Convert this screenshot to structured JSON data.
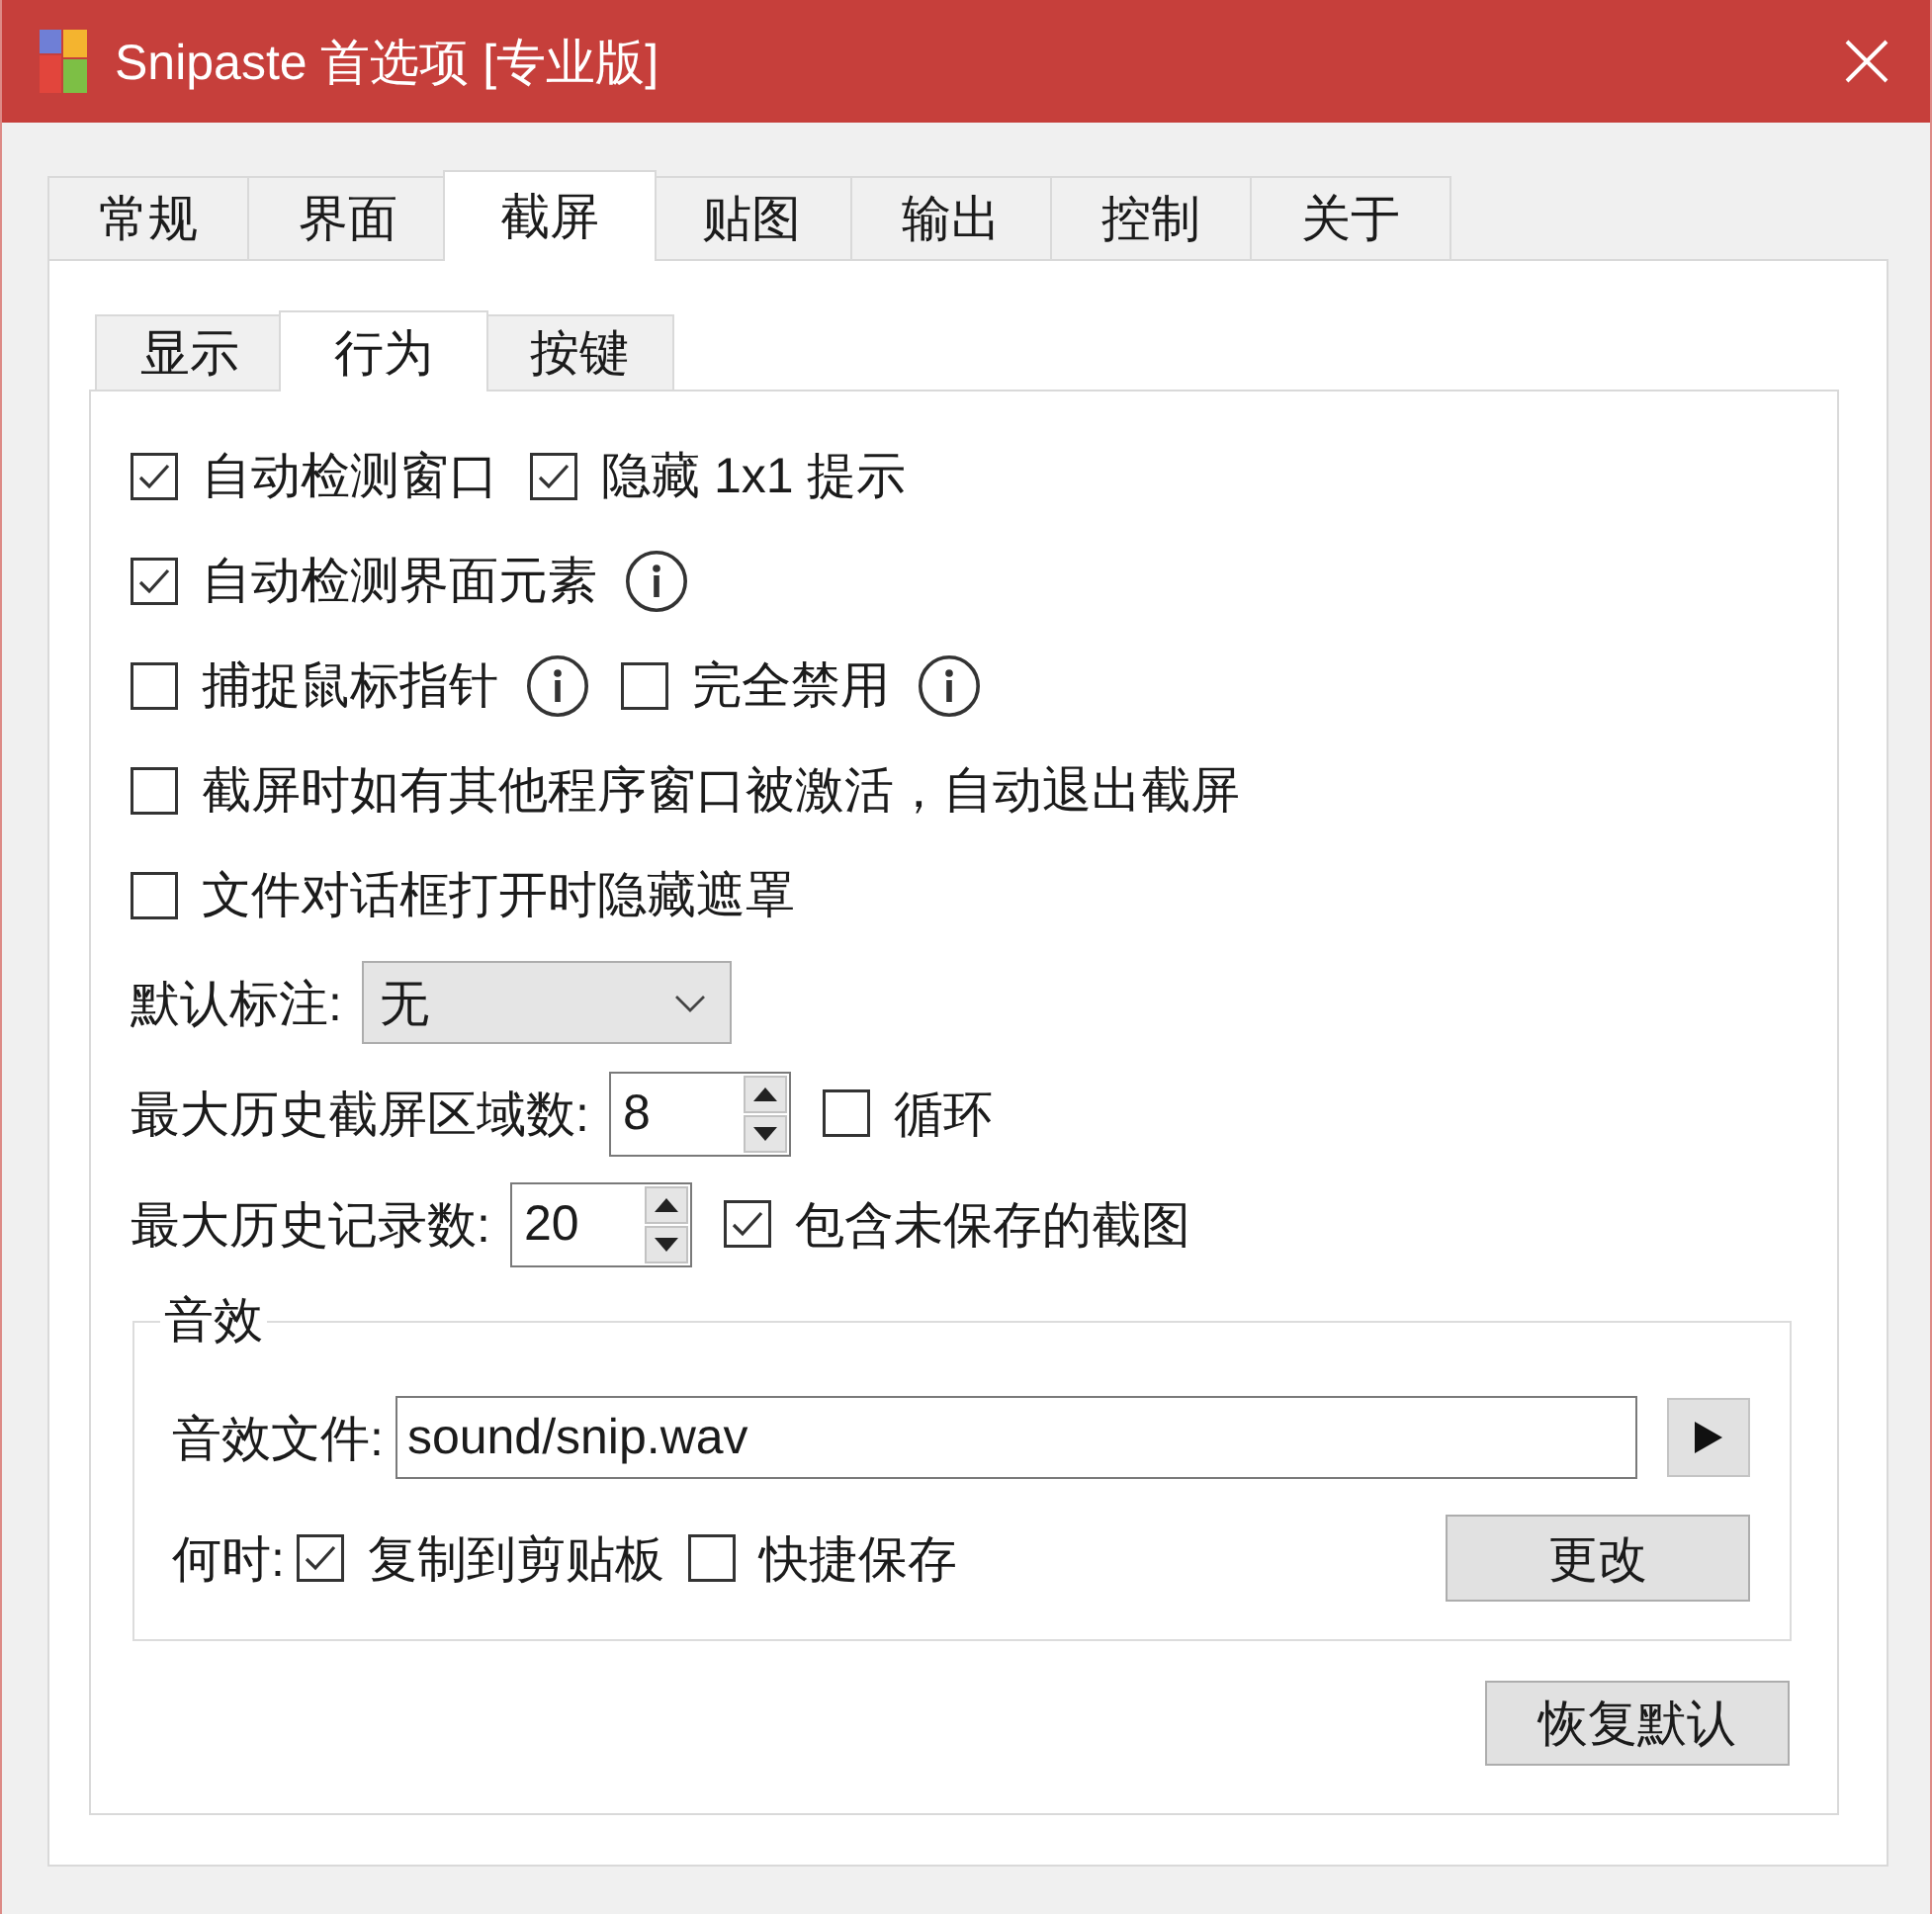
{
  "window": {
    "title": "Snipaste 首选项 [专业版]"
  },
  "tabs": [
    {
      "label": "常规",
      "selected": false
    },
    {
      "label": "界面",
      "selected": false
    },
    {
      "label": "截屏",
      "selected": true
    },
    {
      "label": "贴图",
      "selected": false
    },
    {
      "label": "输出",
      "selected": false
    },
    {
      "label": "控制",
      "selected": false
    },
    {
      "label": "关于",
      "selected": false
    }
  ],
  "subtabs": [
    {
      "label": "显示",
      "selected": false
    },
    {
      "label": "行为",
      "selected": true
    },
    {
      "label": "按键",
      "selected": false
    }
  ],
  "rows": [
    {
      "items": [
        {
          "kind": "checkbox",
          "label": "自动检测窗口",
          "checked": true
        },
        {
          "kind": "checkbox",
          "label": "隐藏 1x1 提示",
          "checked": true
        }
      ]
    },
    {
      "items": [
        {
          "kind": "checkbox",
          "label": "自动检测界面元素",
          "checked": true
        },
        {
          "kind": "info"
        }
      ]
    },
    {
      "items": [
        {
          "kind": "checkbox",
          "label": "捕捉鼠标指针",
          "checked": false
        },
        {
          "kind": "info"
        },
        {
          "kind": "checkbox",
          "label": "完全禁用",
          "checked": false
        },
        {
          "kind": "info"
        }
      ]
    },
    {
      "items": [
        {
          "kind": "checkbox",
          "label": "截屏时如有其他程序窗口被激活，自动退出截屏",
          "checked": false
        }
      ]
    },
    {
      "items": [
        {
          "kind": "checkbox",
          "label": "文件对话框打开时隐藏遮罩",
          "checked": false
        }
      ]
    },
    {
      "items": [
        {
          "kind": "label",
          "text": "默认标注:"
        },
        {
          "kind": "select",
          "value": "无"
        }
      ]
    },
    {
      "items": [
        {
          "kind": "label",
          "text": "最大历史截屏区域数:"
        },
        {
          "kind": "spinbox",
          "value": "8"
        },
        {
          "kind": "checkbox",
          "label": "循环",
          "checked": false
        }
      ]
    },
    {
      "items": [
        {
          "kind": "label",
          "text": "最大历史记录数:"
        },
        {
          "kind": "spinbox",
          "value": "20"
        },
        {
          "kind": "checkbox",
          "label": "包含未保存的截图",
          "checked": true
        }
      ]
    }
  ],
  "sound": {
    "title": "音效",
    "file_label": "音效文件:",
    "file_path": "sound/snip.wav",
    "when_label": "何时:",
    "options": [
      {
        "label": "复制到剪贴板",
        "checked": true
      },
      {
        "label": "快捷保存",
        "checked": false
      }
    ],
    "change_button": "更改"
  },
  "restore_button": "恢复默认"
}
